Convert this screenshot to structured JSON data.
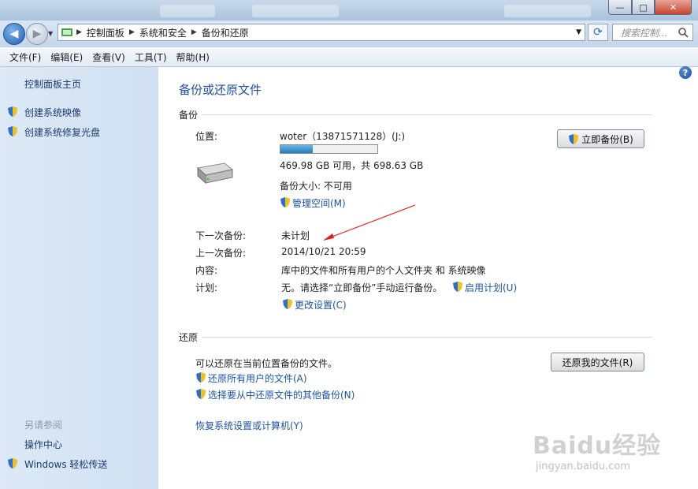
{
  "address": {
    "crumbs": [
      "控制面板",
      "系统和安全",
      "备份和还原"
    ],
    "search_placeholder": "搜索控制..."
  },
  "menu": [
    "文件(F)",
    "编辑(E)",
    "查看(V)",
    "工具(T)",
    "帮助(H)"
  ],
  "sidebar": {
    "home": "控制面板主页",
    "tasks": [
      "创建系统映像",
      "创建系统修复光盘"
    ],
    "see_also_title": "另请参阅",
    "see_also": [
      "操作中心",
      "Windows 轻松传送"
    ]
  },
  "main": {
    "title": "备份或还原文件",
    "backup": {
      "section_label": "备份",
      "location_label": "位置:",
      "drive_name": "woter（13871571128）(J:)",
      "drive_usage_fraction": 0.33,
      "drive_space": "469.98 GB 可用，共 698.63 GB",
      "backup_size": "备份大小: 不可用",
      "manage_space_link": "管理空间(M)",
      "backup_now_button": "立即备份(B)",
      "next_label": "下一次备份:",
      "next_value": "未计划",
      "last_label": "上一次备份:",
      "last_value": "2014/10/21 20:59",
      "contents_label": "内容:",
      "contents_value": "库中的文件和所有用户的个人文件夹 和 系统映像",
      "schedule_label": "计划:",
      "schedule_value": "无。请选择“立即备份”手动运行备份。",
      "enable_schedule_link": "启用计划(U)",
      "change_settings_link": "更改设置(C)"
    },
    "restore": {
      "section_label": "还原",
      "description": "可以还原在当前位置备份的文件。",
      "restore_my_files_button": "还原我的文件(R)",
      "restore_all_users_link": "还原所有用户的文件(A)",
      "select_other_link": "选择要从中还原文件的其他备份(N)",
      "recover_link": "恢复系统设置或计算机(Y)"
    }
  },
  "watermark": {
    "logo_text": "Baidu经验",
    "url": "jingyan.baidu.com"
  },
  "colors": {
    "link": "#1a55a8",
    "title": "#1e4fa0",
    "arrow": "#e02020"
  }
}
